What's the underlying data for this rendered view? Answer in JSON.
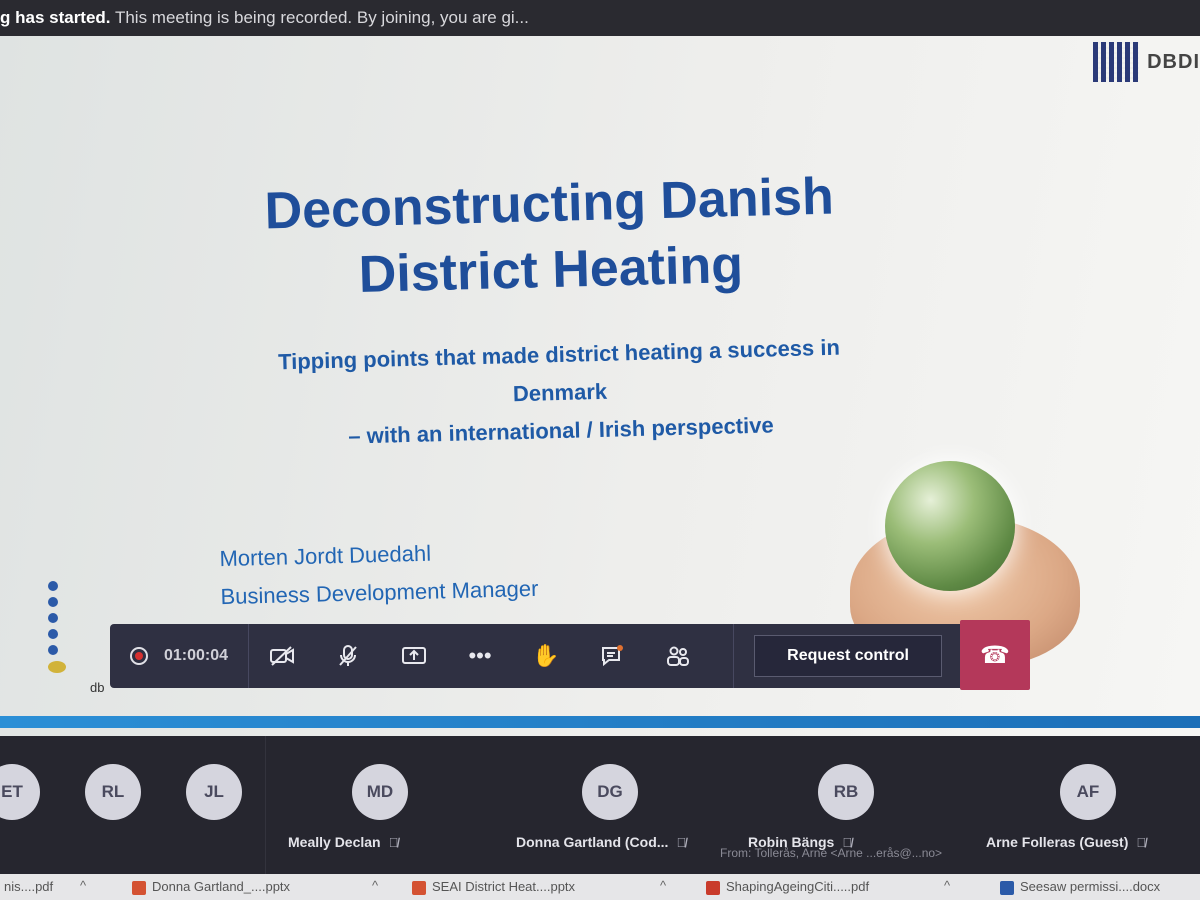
{
  "banner": {
    "bold": "g has started.",
    "text": " This meeting is being recorded. By joining, you are gi..."
  },
  "slide": {
    "logo_text": "DBDI",
    "title_line1": "Deconstructing Danish",
    "title_line2": "District Heating",
    "subtitle_line1": "Tipping points that made district heating a success in",
    "subtitle_line2": "Denmark",
    "subtitle_line3": "– with an international / Irish perspective",
    "presenter_name": "Morten Jordt Duedahl",
    "presenter_role": "Business Development Manager",
    "footer_text": "db"
  },
  "toolbar": {
    "timer": "01:00:04",
    "request_control": "Request control",
    "icons": [
      "record-icon",
      "camera-off-icon",
      "mic-off-icon",
      "share-screen-icon",
      "more-options-icon",
      "raise-hand-icon",
      "chat-icon",
      "participants-icon",
      "hang-up-icon"
    ]
  },
  "participants": [
    {
      "initials": "ET",
      "name": ""
    },
    {
      "initials": "RL",
      "name": ""
    },
    {
      "initials": "JL",
      "name": ""
    },
    {
      "initials": "MD",
      "name": "Meally Declan"
    },
    {
      "initials": "DG",
      "name": "Donna Gartland (Cod..."
    },
    {
      "initials": "RB",
      "name": "Robin Bängs"
    },
    {
      "initials": "AF",
      "name": "Arne Folleras (Guest)"
    }
  ],
  "ghost_text": "From: Tollerås, Arne <Arne ...erås@...no>",
  "taskbar": [
    {
      "label": "nis....pdf",
      "type": "pdf"
    },
    {
      "label": "Donna Gartland_....pptx",
      "type": "ppt"
    },
    {
      "label": "SEAI District Heat....pptx",
      "type": "ppt"
    },
    {
      "label": "ShapingAgeingCiti.....pdf",
      "type": "pdf"
    },
    {
      "label": "Seesaw permissi....docx",
      "type": "doc"
    }
  ]
}
